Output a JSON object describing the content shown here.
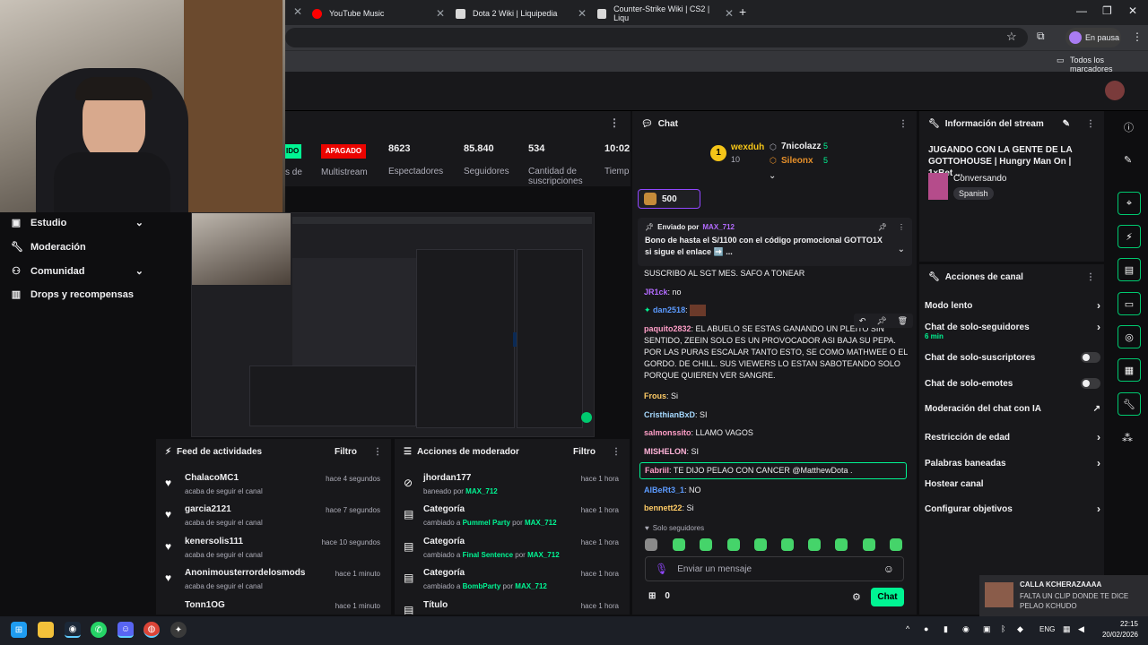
{
  "browser": {
    "tabs": [
      {
        "label": "YouTube Music",
        "color": "#ff0000"
      },
      {
        "label": "Dota 2 Wiki | Liquipedia",
        "color": "#d9d9d9"
      },
      {
        "label": "Counter-Strike Wiki | CS2 | Liqu",
        "color": "#d9d9d9"
      }
    ],
    "profile_label": "En pausa",
    "bookmarks_label": "Todos los marcadores"
  },
  "stats": {
    "live_badge": "IDO",
    "offline_badge": "APAGADO",
    "multistream": "Multistream",
    "spectators_value": "8623",
    "spectators_label": "Espectadores",
    "followers_value": "85.840",
    "followers_label": "Seguidores",
    "subs_value": "534",
    "subs_label": "Cantidad de suscripciones",
    "time_value": "10:02",
    "time_label": "Tiemp en vi",
    "partial_label": "s de"
  },
  "sidebar": {
    "items": [
      {
        "label": "Estudio",
        "glyph": "studio-icon",
        "chevron": true
      },
      {
        "label": "Moderación",
        "glyph": "wrench-icon",
        "chevron": false
      },
      {
        "label": "Comunidad",
        "glyph": "community-icon",
        "chevron": true
      },
      {
        "label": "Drops y recompensas",
        "glyph": "drops-icon",
        "chevron": false
      }
    ]
  },
  "feed": {
    "title": "Feed de actividades",
    "filter": "Filtro",
    "rows": [
      {
        "name": "ChalacoMC1",
        "sub": "acaba de seguir el canal",
        "time": "hace 4 segundos"
      },
      {
        "name": "garcia2121",
        "sub": "acaba de seguir el canal",
        "time": "hace 7 segundos"
      },
      {
        "name": "kenersolis111",
        "sub": "acaba de seguir el canal",
        "time": "hace 10 segundos"
      },
      {
        "name": "Anonimousterrordelosmods",
        "sub": "acaba de seguir el canal",
        "time": "hace 1 minuto"
      },
      {
        "name": "Tonn1OG",
        "sub": "",
        "time": "hace 1 minuto"
      }
    ]
  },
  "modactions": {
    "title": "Acciones de moderador",
    "filter": "Filtro",
    "rows": [
      {
        "name": "jhordan177",
        "pre": "baneado por ",
        "target": "",
        "mid": "",
        "by": "MAX_712",
        "time": "hace 1 hora"
      },
      {
        "name": "Categoría",
        "pre": "cambiado a ",
        "target": "Pummel Party",
        "mid": " por ",
        "by": "MAX_712",
        "time": "hace 1 hora"
      },
      {
        "name": "Categoría",
        "pre": "cambiado a ",
        "target": "Final Sentence",
        "mid": " por ",
        "by": "MAX_712",
        "time": "hace 1 hora"
      },
      {
        "name": "Categoría",
        "pre": "cambiado a ",
        "target": "BombParty",
        "mid": " por ",
        "by": "MAX_712",
        "time": "hace 1 hora"
      },
      {
        "name": "Título",
        "pre": "",
        "target": "",
        "mid": "",
        "by": "",
        "time": "hace 1 hora"
      }
    ]
  },
  "chat": {
    "title": "Chat",
    "leader1_name": "wexduh",
    "leader1_count": "10",
    "leader2_name": "7nicolazz",
    "leader2_count": "5",
    "leader3_name": "Sileonx",
    "leader3_count": "5",
    "points": "500",
    "pinned_by_label": "Enviado por",
    "pinned_user": "MAX_712",
    "pinned_text": "Bono de hasta el S/1100 con el código promocional GOTTO1X si sigue el enlace ➡️ ...",
    "messages": [
      {
        "user": "",
        "color": "#efeff1",
        "text": "SUSCRIBO AL SGT MES. SAFO A TONEAR"
      },
      {
        "user": "JR1ck",
        "color": "#b36bff",
        "text": " no"
      },
      {
        "user": "dan2518",
        "color": "#5c9bff",
        "text": ""
      },
      {
        "user": "paquito2832",
        "color": "#ff9ec7",
        "text": " EL ABUELO SE ESTAS GANANDO UN PLEITO SIN SENTIDO, ZEEIN SOLO ES UN PROVOCADOR ASI BAJA SU PEPA. POR LAS PURAS ESCALAR TANTO ESTO, SE COMO MATHWEE O EL GORDO. DE CHILL. SUS VIEWERS LO ESTAN SABOTEANDO SOLO PORQUE QUIEREN VER SANGRE."
      },
      {
        "user": "Frous",
        "color": "#ffcc66",
        "text": " Si"
      },
      {
        "user": "CristhianBxD",
        "color": "#a6d9ff",
        "text": " SI"
      },
      {
        "user": "salmonssito",
        "color": "#ff9ec7",
        "text": " LLAMO VAGOS"
      },
      {
        "user": "MISHELON",
        "color": "#ffb3d9",
        "text": " SI"
      },
      {
        "user": "Fabriil",
        "color": "#ff9ec7",
        "text": " TE DIJO PELAO CON CANCER @MatthewDota ."
      },
      {
        "user": "AlBeRt3_1",
        "color": "#5c9bff",
        "text": " NO"
      },
      {
        "user": "bennett22",
        "color": "#ffcc66",
        "text": " Si"
      }
    ],
    "followers_only": "Solo seguidores",
    "input_placeholder": "Enviar un mensaje",
    "bits": "0",
    "send": "Chat"
  },
  "info": {
    "title": "Información del stream",
    "stream_title": "JUGANDO CON LA GENTE DE LA GOTTOHOUSE | Hungry Man On | 1xBet ...",
    "category": "Conversando",
    "language": "Spanish"
  },
  "channel_actions": {
    "title": "Acciones de canal",
    "items": [
      {
        "label": "Modo lento",
        "kind": "chev"
      },
      {
        "label": "Chat de solo-seguidores",
        "kind": "chev",
        "note": "6 min"
      },
      {
        "label": "Chat de solo-suscriptores",
        "kind": "toggle"
      },
      {
        "label": "Chat de solo-emotes",
        "kind": "toggle"
      },
      {
        "label": "Moderación del chat con IA",
        "kind": "ext"
      },
      {
        "label": "Restricción de edad",
        "kind": "chev"
      },
      {
        "label": "Palabras baneadas",
        "kind": "chev"
      },
      {
        "label": "Hostear canal",
        "kind": "none"
      },
      {
        "label": "Configurar objetivos",
        "kind": "chev"
      }
    ]
  },
  "notification": {
    "title": "CALLA KCHERAZAAAA",
    "body": "FALTA UN CLIP DONDE TE DICE PELAO KCHUDO"
  },
  "taskbar": {
    "lang": "ENG",
    "time": "22:15",
    "date": "20/02/2026"
  },
  "colors": {
    "accent": "#00f593",
    "twitch_purple": "#9147ff",
    "offline_red": "#eb0400"
  }
}
